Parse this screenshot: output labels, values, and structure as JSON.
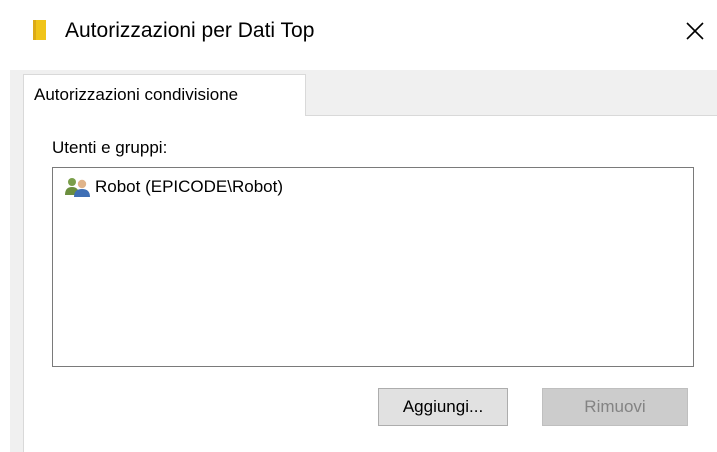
{
  "window": {
    "title": "Autorizzazioni per Dati Top",
    "title_icon": "folder-icon",
    "close_icon": "close-icon"
  },
  "tabs": [
    {
      "label": "Autorizzazioni condivisione",
      "selected": true
    }
  ],
  "users_panel": {
    "label": "Utenti e gruppi:",
    "items": [
      {
        "icon": "users-group-icon",
        "text": "Robot (EPICODE\\Robot)"
      }
    ]
  },
  "buttons": {
    "add_label": "Aggiungi...",
    "remove_label": "Rimuovi",
    "remove_enabled": false
  },
  "colors": {
    "folder": "#f0c419",
    "panel_background": "#f0f0f0",
    "disabled_button": "#cccccc",
    "disabled_text": "#838383"
  }
}
